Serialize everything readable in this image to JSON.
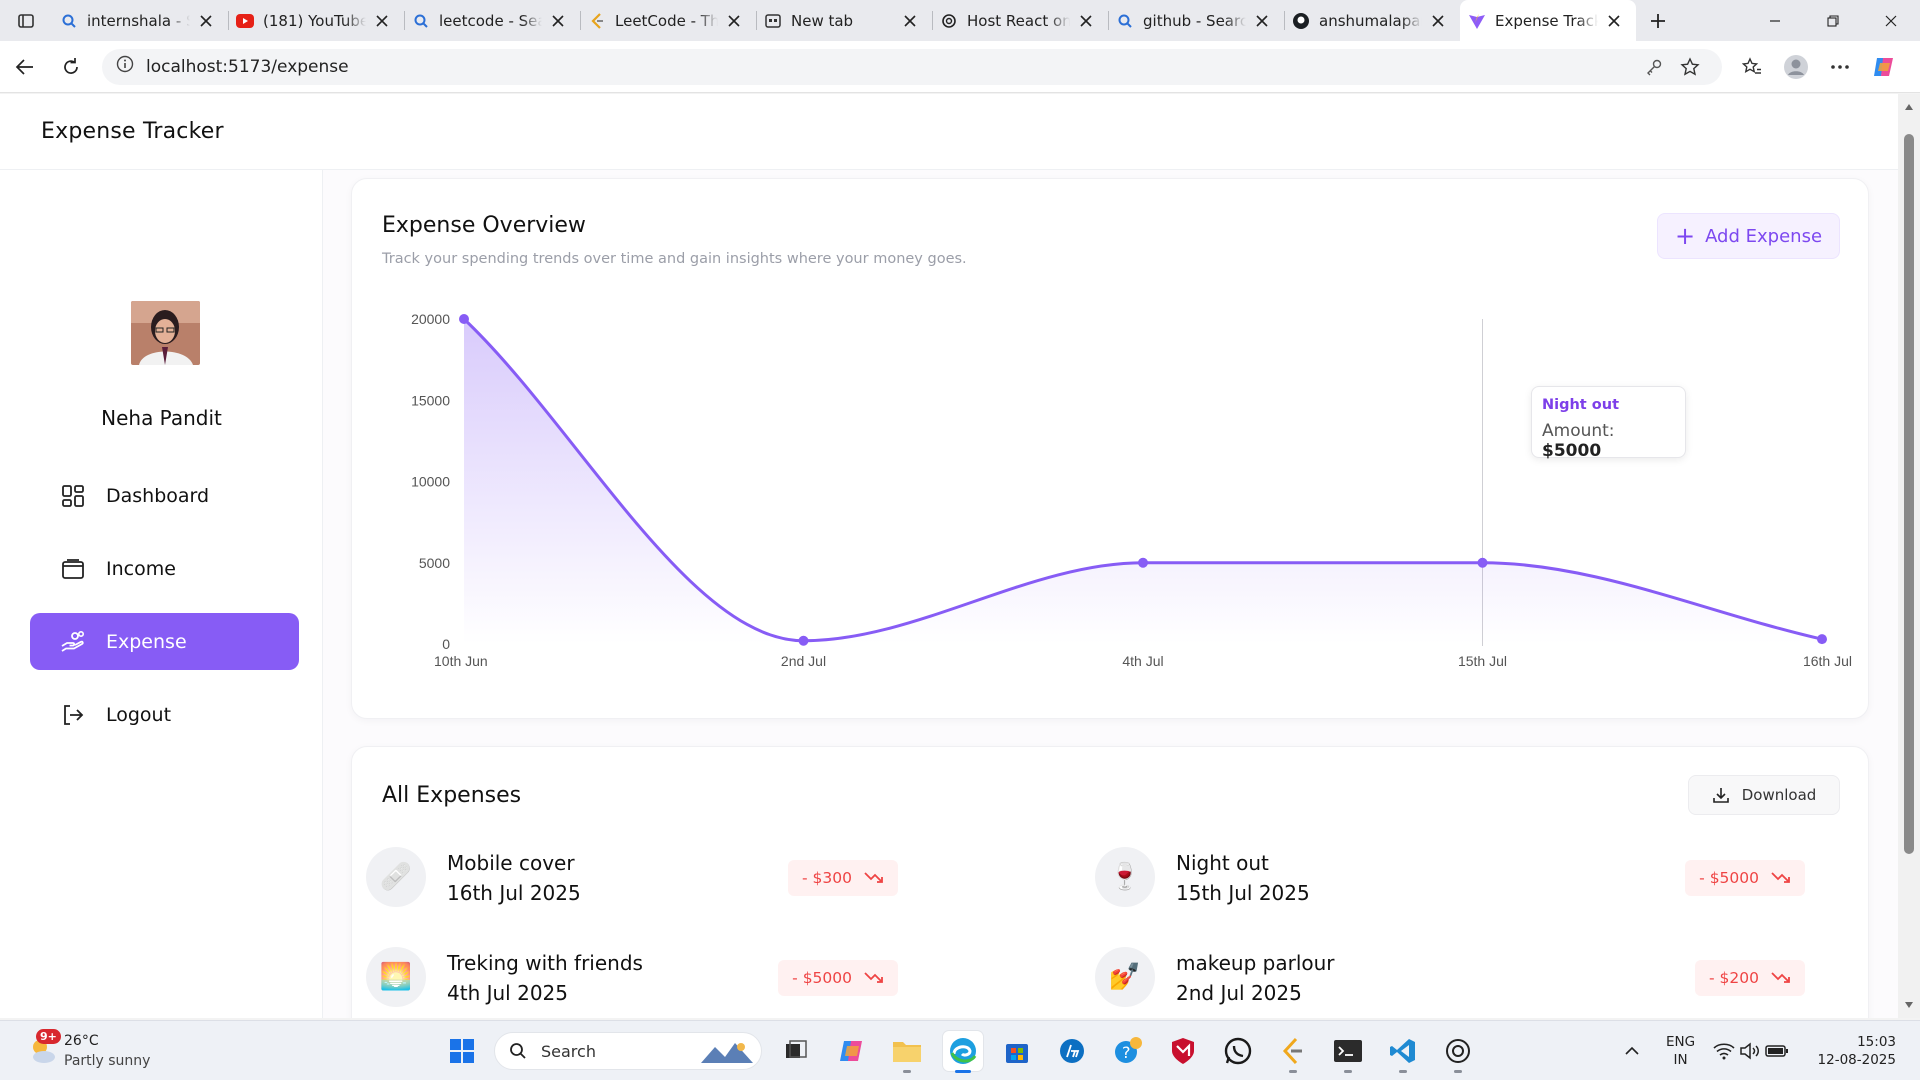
{
  "browser": {
    "tabs": [
      {
        "title": "internshala - Search",
        "icon": "search-icon"
      },
      {
        "title": "(181) YouTube",
        "icon": "youtube-icon"
      },
      {
        "title": "leetcode - Search",
        "icon": "search-icon"
      },
      {
        "title": "LeetCode - The World's Leading",
        "icon": "leetcode-icon"
      },
      {
        "title": "New tab",
        "icon": "newtab-icon"
      },
      {
        "title": "Host React on Render",
        "icon": "openai-icon"
      },
      {
        "title": "github - Search",
        "icon": "search-icon"
      },
      {
        "title": "anshumalapandit",
        "icon": "github-icon"
      },
      {
        "title": "Expense Tracker",
        "icon": "vite-icon",
        "active": true
      }
    ],
    "url": "localhost:5173/expense"
  },
  "app": {
    "title": "Expense Tracker",
    "user": {
      "name": "Neha Pandit"
    },
    "nav": [
      {
        "label": "Dashboard",
        "icon": "dashboard-icon"
      },
      {
        "label": "Income",
        "icon": "wallet-icon"
      },
      {
        "label": "Expense",
        "icon": "hand-coins-icon",
        "active": true
      },
      {
        "label": "Logout",
        "icon": "logout-icon"
      }
    ],
    "accent": "#875cf5"
  },
  "overview": {
    "title": "Expense Overview",
    "subtitle": "Track your spending trends over time and gain insights where your money goes.",
    "add_button": "Add Expense",
    "tooltip": {
      "category": "Night out",
      "amount_label": "Amount:",
      "amount": "$5000"
    }
  },
  "chart_data": {
    "type": "area",
    "categories": [
      "10th Jun",
      "2nd Jul",
      "4th Jul",
      "15th Jul",
      "16th Jul"
    ],
    "values": [
      20000,
      200,
      5000,
      5000,
      300
    ],
    "yticks": [
      0,
      5000,
      10000,
      15000,
      20000
    ],
    "ylim": [
      0,
      20000
    ],
    "highlight_index": 3,
    "color": "#875cf5"
  },
  "expenses": {
    "title": "All Expenses",
    "download_label": "Download",
    "items": [
      {
        "name": "Mobile cover",
        "date": "16th Jul 2025",
        "amount": "- $300",
        "emoji": "🩹"
      },
      {
        "name": "Night out",
        "date": "15th Jul 2025",
        "amount": "- $5000",
        "emoji": "🍷"
      },
      {
        "name": "Treking with friends",
        "date": "4th Jul 2025",
        "amount": "- $5000",
        "emoji": "🌅"
      },
      {
        "name": "makeup parlour",
        "date": "2nd Jul 2025",
        "amount": "- $200",
        "emoji": "💅"
      }
    ]
  },
  "taskbar": {
    "weather": {
      "badge": "9+",
      "temp": "26°C",
      "condition": "Partly sunny"
    },
    "search_label": "Search",
    "lang": [
      "ENG",
      "IN"
    ],
    "time": "15:03",
    "date": "12-08-2025"
  }
}
